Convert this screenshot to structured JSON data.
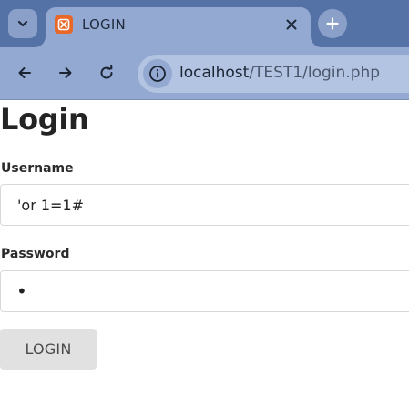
{
  "browser": {
    "tab_title": "LOGIN",
    "url_host": "localhost",
    "url_path": "/TEST1/login.php",
    "colors": {
      "tabstrip": "#5472a6",
      "toolbar": "#94a9d1",
      "favicon": "#e8682a"
    }
  },
  "page": {
    "title": "Login",
    "username": {
      "label": "Username",
      "value": "'or 1=1#"
    },
    "password": {
      "label": "Password",
      "value": "x"
    },
    "submit_label": "LOGIN"
  },
  "icons": [
    "chevron-down-icon",
    "xampp-favicon-icon",
    "close-icon",
    "plus-icon",
    "back-arrow-icon",
    "forward-arrow-icon",
    "reload-icon",
    "info-icon"
  ]
}
